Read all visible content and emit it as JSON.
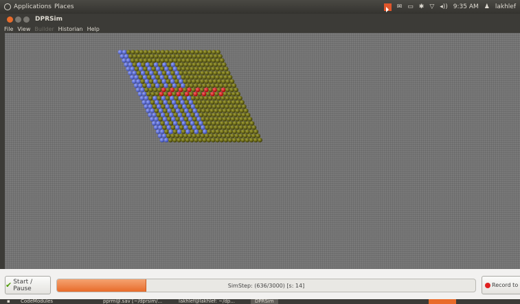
{
  "top_panel": {
    "applications": "Applications",
    "places": "Places",
    "time": "9:35 AM",
    "user": "lakhlef",
    "volume_glyph": "◂))",
    "user_glyph": "♟"
  },
  "window": {
    "title": "DPRSim"
  },
  "menu": {
    "file": "File",
    "view": "View",
    "builder": "Builder",
    "historian": "Historian",
    "help": "Help"
  },
  "colors": {
    "ball_olive": "#6b6a10",
    "ball_blue": "#5f70d8",
    "ball_red": "#e01818",
    "progress": "#e86b2a"
  },
  "controls": {
    "start_pause": "Start / Pause",
    "check_glyph": "✔",
    "simstep": "SimStep: (636/3000) [s: 14]",
    "progress_fraction": 0.212,
    "record": "Record to D"
  },
  "taskbar": {
    "t1": "CodeModules",
    "t2": "pprm@.sav [~/dprsim/...",
    "t3": "lakhlef@lakhlef: ~/dp...",
    "t4": "DPRSim"
  }
}
